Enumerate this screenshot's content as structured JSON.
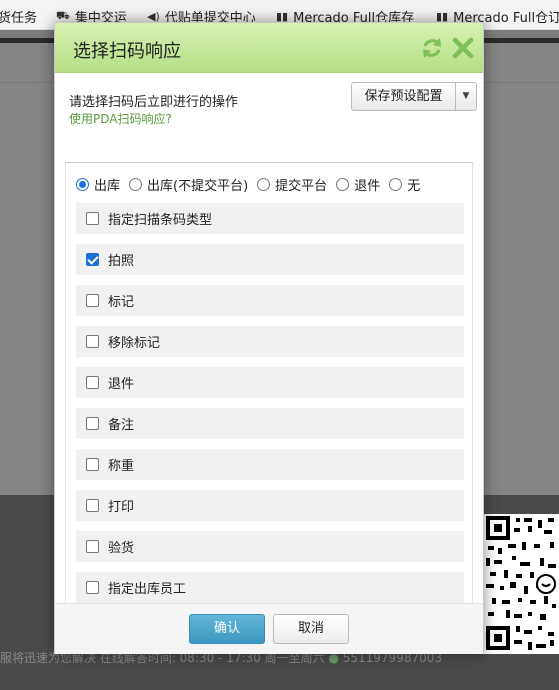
{
  "bookmarks": [
    {
      "icon": "none",
      "label": "货任务"
    },
    {
      "icon": "truck-icon",
      "label": "集中交运"
    },
    {
      "icon": "speaker-icon",
      "label": "代贴单提交中心"
    },
    {
      "icon": "barcode-icon",
      "label": "Mercado Full仓库存"
    },
    {
      "icon": "barcode-icon",
      "label": "Mercado Full仓订"
    }
  ],
  "footer": {
    "text": "服将迅速为您解决 在线解答时间: 08:30 - 17:30 周一至周六",
    "phone": "5511979987003"
  },
  "dialog": {
    "title": "选择扫码响应",
    "prompt": "请选择扫码后立即进行的操作",
    "pda_link": "使用PDA扫码响应?",
    "preset_button": "保存预设配置",
    "radio_options": [
      {
        "label": "出库",
        "checked": true
      },
      {
        "label": "出库(不提交平台)",
        "checked": false
      },
      {
        "label": "提交平台",
        "checked": false
      },
      {
        "label": "退件",
        "checked": false
      },
      {
        "label": "无",
        "checked": false
      }
    ],
    "checkbox_options": [
      {
        "label": "指定扫描条码类型",
        "checked": false
      },
      {
        "label": "拍照",
        "checked": true
      },
      {
        "label": "标记",
        "checked": false
      },
      {
        "label": "移除标记",
        "checked": false
      },
      {
        "label": "退件",
        "checked": false
      },
      {
        "label": "备注",
        "checked": false
      },
      {
        "label": "称重",
        "checked": false
      },
      {
        "label": "打印",
        "checked": false
      },
      {
        "label": "验货",
        "checked": false
      },
      {
        "label": "指定出库员工",
        "checked": false
      }
    ],
    "confirm_button": "确认",
    "cancel_button": "取消"
  },
  "colors": {
    "header_green": "#b5df86",
    "accent_blue": "#1e6fd9",
    "confirm_blue": "#3c97c0",
    "link_green": "#5a9b3d"
  }
}
